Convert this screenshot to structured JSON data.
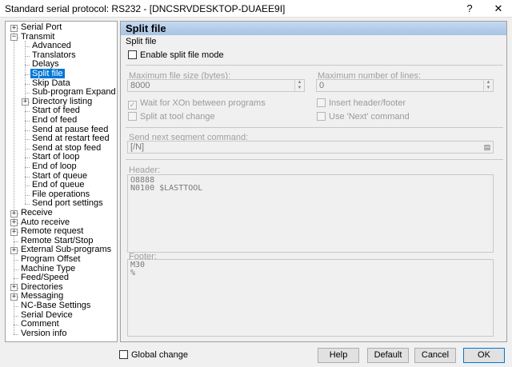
{
  "window": {
    "title": "Standard serial protocol: RS232 - [DNCSRVDESKTOP-DUAEE9I]",
    "help_glyph": "?",
    "close_glyph": "✕"
  },
  "tree": [
    {
      "label": "Serial Port",
      "level": 0,
      "exp": "+"
    },
    {
      "label": "Transmit",
      "level": 0,
      "exp": "−"
    },
    {
      "label": "Advanced",
      "level": 1
    },
    {
      "label": "Translators",
      "level": 1
    },
    {
      "label": "Delays",
      "level": 1
    },
    {
      "label": "Split file",
      "level": 1,
      "selected": true
    },
    {
      "label": "Skip Data",
      "level": 1
    },
    {
      "label": "Sub-program Expand",
      "level": 1
    },
    {
      "label": "Directory listing",
      "level": 1,
      "exp": "+"
    },
    {
      "label": "Start of feed",
      "level": 1
    },
    {
      "label": "End of feed",
      "level": 1
    },
    {
      "label": "Send at pause feed",
      "level": 1
    },
    {
      "label": "Send at restart feed",
      "level": 1
    },
    {
      "label": "Send at stop feed",
      "level": 1
    },
    {
      "label": "Start of loop",
      "level": 1
    },
    {
      "label": "End of loop",
      "level": 1
    },
    {
      "label": "Start of queue",
      "level": 1
    },
    {
      "label": "End of queue",
      "level": 1
    },
    {
      "label": "File operations",
      "level": 1
    },
    {
      "label": "Send port settings",
      "level": 1
    },
    {
      "label": "Receive",
      "level": 0,
      "exp": "+"
    },
    {
      "label": "Auto receive",
      "level": 0,
      "exp": "+"
    },
    {
      "label": "Remote request",
      "level": 0,
      "exp": "+"
    },
    {
      "label": "Remote Start/Stop",
      "level": 0
    },
    {
      "label": "External Sub-programs",
      "level": 0,
      "exp": "+"
    },
    {
      "label": "Program Offset",
      "level": 0
    },
    {
      "label": "Machine Type",
      "level": 0
    },
    {
      "label": "Feed/Speed",
      "level": 0
    },
    {
      "label": "Directories",
      "level": 0,
      "exp": "+"
    },
    {
      "label": "Messaging",
      "level": 0,
      "exp": "+"
    },
    {
      "label": "NC-Base Settings",
      "level": 0
    },
    {
      "label": "Serial Device",
      "level": 0
    },
    {
      "label": "Comment",
      "level": 0
    },
    {
      "label": "Version info",
      "level": 0
    }
  ],
  "panel": {
    "title": "Split file",
    "group": "Split file",
    "enable_label": "Enable split file mode",
    "max_size_label": "Maximum file size (bytes):",
    "max_size_value": "8000",
    "max_lines_label": "Maximum number of lines:",
    "max_lines_value": "0",
    "wait_xon_label": "Wait for XOn between programs",
    "split_tool_label": "Split at tool change",
    "insert_header_label": "Insert header/footer",
    "use_next_label": "Use 'Next' command",
    "send_next_label": "Send next segment command:",
    "send_next_value": "[/N]",
    "header_label": "Header:",
    "header_lines": [
      "O8888",
      "N0100 $LASTTOOL"
    ],
    "footer_label": "Footer:",
    "footer_lines": [
      "M30",
      "%"
    ],
    "check_glyph": "✓",
    "spin_up": "▲",
    "spin_down": "▼",
    "browse_glyph": "▤"
  },
  "footer": {
    "global_change_label": "Global change",
    "help": "Help",
    "default": "Default",
    "cancel": "Cancel",
    "ok": "OK"
  }
}
